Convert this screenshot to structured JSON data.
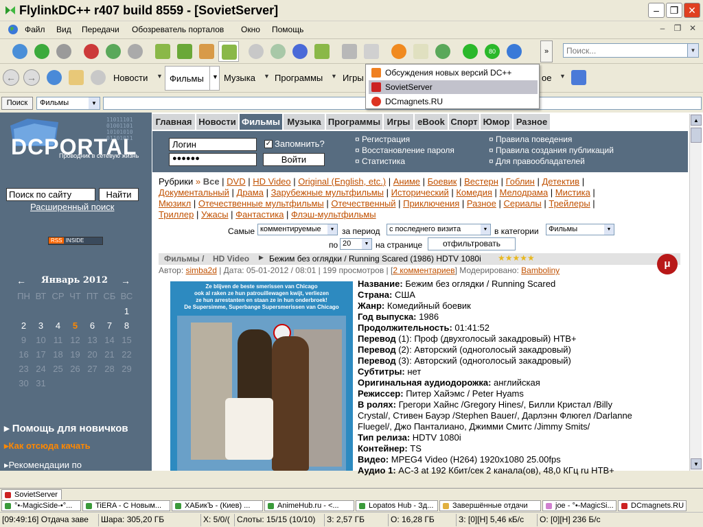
{
  "window": {
    "title": "FlylinkDC++ r407 build 8559 - [SovietServer]",
    "minimize": "–",
    "maximize": "❐",
    "close": "✕"
  },
  "menu": [
    "Файл",
    "Вид",
    "Передачи",
    "Обозреватель порталов",
    "Окно",
    "Помощь"
  ],
  "search_placeholder": "Поиск...",
  "toolbar2": {
    "news": "Новости",
    "films": "Фильмы",
    "music": "Музыка",
    "programs": "Программы",
    "games": "Игры",
    "more": "ое"
  },
  "dropdown": [
    {
      "label": "Обсуждения новых версий DC++",
      "color": "#f08020",
      "selected": false
    },
    {
      "label": "SovietServer",
      "color": "#cc2222",
      "selected": true
    },
    {
      "label": "DCmagnets.RU",
      "color": "#dd3322",
      "selected": false
    }
  ],
  "addr": {
    "button": "Поиск",
    "select": "Фильмы"
  },
  "sidebar": {
    "logo": "DCPORTAL",
    "tagline": "Проводник в сетевую жизнь",
    "search_value": "Поиск по сайту",
    "find": "Найти",
    "advanced": "Расширенный поиск",
    "rss1": "RSS",
    "rss2": "INSIDE",
    "help": "Помощь для новичков",
    "how": "Как отсюда качать",
    "rec": "Рекомендации по"
  },
  "calendar": {
    "title": "Январь 2012",
    "prev": "←",
    "next": "→",
    "days": [
      "ПН",
      "ВТ",
      "СР",
      "ЧТ",
      "ПТ",
      "СБ",
      "ВС"
    ],
    "rows": [
      [
        "",
        "",
        "",
        "",
        "",
        "",
        "1"
      ],
      [
        "2",
        "3",
        "4",
        "5",
        "6",
        "7",
        "8"
      ],
      [
        "9",
        "10",
        "11",
        "12",
        "13",
        "14",
        "15"
      ],
      [
        "16",
        "17",
        "18",
        "19",
        "20",
        "21",
        "22"
      ],
      [
        "23",
        "24",
        "25",
        "26",
        "27",
        "28",
        "29"
      ],
      [
        "30",
        "31",
        "",
        "",
        "",
        "",
        ""
      ]
    ],
    "today": "5"
  },
  "topnav": [
    "Главная",
    "Новости",
    "Фильмы",
    "Музыка",
    "Программы",
    "Игры",
    "eBook",
    "Спорт",
    "Юмор",
    "Разное"
  ],
  "login": {
    "login": "Логин",
    "password": "●●●●●●",
    "remember": "Запомнить?",
    "enter": "Войти",
    "links1": [
      "Регистрация",
      "Восстановление пароля",
      "Статистика"
    ],
    "links2": [
      "Правила поведения",
      "Правила создания публикаций",
      "Для правообладателей"
    ]
  },
  "rubrics": {
    "label": "Рубрики",
    "all": "Все",
    "line1": [
      "DVD",
      "HD Video",
      "Original (English, etc.)",
      "Аниме",
      "Боевик",
      "Вестерн",
      "Гоблин",
      "Детектив"
    ],
    "line2": [
      "Документальный",
      "Драма",
      "Зарубежные мультфильмы",
      "Исторический",
      "Комедия",
      "Мелодрама",
      "Мистика"
    ],
    "line3": [
      "Мюзикл",
      "Отечественные мультфильмы",
      "Отечественный",
      "Приключения",
      "Разное",
      "Сериалы",
      "Трейлеры"
    ],
    "line4": [
      "Триллер",
      "Ужасы",
      "Фантастика",
      "Флэш-мультфильмы"
    ]
  },
  "filter": {
    "most": "Самые",
    "most_val": "комментируемые",
    "period": "за период",
    "period_val": "с последнего визита",
    "cat": "в категории",
    "cat_val": "Фильмы",
    "per": "по",
    "per_val": "20",
    "per_page": "на странице",
    "btn": "отфильтровать"
  },
  "crumb": {
    "c1": "Фильмы /",
    "c2": "HD Video",
    "title": "Бежим без оглядки / Running Scared (1986) HDTV 1080i",
    "stars": "★★★★★"
  },
  "meta": {
    "author_label": "Автор:",
    "author": "simba2d",
    "date": "| Дата: 05-01-2012 / 08:01 | 199 просмотров | [",
    "comments": "2 комментариев",
    "mod": "] Модерировано:",
    "moderator": "Bambolinу"
  },
  "poster_text": [
    "Ze blijven de beste smerissen van Chicago",
    "ook al raken ze hun patrouillewagen kwijt, verliezen",
    "ze hun arrestanten en staan ze in hun onderbroek!",
    "De Supersimme, Superbange Supersmerissen van Chicago"
  ],
  "details": [
    {
      "k": "Название:",
      "v": "Бежим без оглядки / Running Scared"
    },
    {
      "k": "Страна:",
      "v": "США"
    },
    {
      "k": "Жанр:",
      "v": "Комедийный боевик"
    },
    {
      "k": "Год выпуска:",
      "v": "1986"
    },
    {
      "k": "Продолжительность:",
      "v": "01:41:52"
    },
    {
      "k": "Перевод",
      "v": "(1): Проф (двухголосый закадровый) НТВ+"
    },
    {
      "k": "Перевод",
      "v": "(2): Авторский (одноголосый закадровый)"
    },
    {
      "k": "Перевод",
      "v": "(3): Авторский (одноголосый закадровый)"
    },
    {
      "k": "Субтитры:",
      "v": "нет"
    },
    {
      "k": "Оригинальная аудиодорожка:",
      "v": "английская"
    },
    {
      "k": "Режиссер:",
      "v": "Питер Хайэмс / Peter Hyams"
    },
    {
      "k": "В ролях:",
      "v": "Грегори Хайнс /Gregory Hines/, Билли Кристал /Billy"
    },
    {
      "k": "",
      "v": "Crystal/, Стивен Бауэр /Stephen Bauer/, Дарлэнн Флюгел /Darlanne"
    },
    {
      "k": "",
      "v": "Fluegel/, Джо Панталиано, Джимми Смитс /Jimmy Smits/"
    },
    {
      "k": "Тип релиза:",
      "v": "HDTV 1080i"
    },
    {
      "k": "Контейнер:",
      "v": "TS"
    },
    {
      "k": "Видео:",
      "v": "MPEG4 Video (H264) 1920x1080 25.00fps"
    },
    {
      "k": "Аудио 1:",
      "v": "AC-3 at 192 Кбит/сек 2 канала(ов), 48,0 КГц ru НТВ+"
    }
  ],
  "tabs_top": "SovietServer",
  "tabs": [
    "°•-MagicSide-•°...",
    "TiERA - С Новым...",
    "ХАБикЪ - (Киев) ...",
    "AnimeHub.ru - <...",
    "Lopatos Hub - Зд...",
    "Завершённые отдачи",
    "joe - °•-MagicSi...",
    "DCmagnets.RU"
  ],
  "status": [
    "[09:49:16] Отдача заве",
    "Шара: 305,20 ГБ",
    "Х: 5/0/(",
    "Слоты: 15/15 (10/10)",
    "З: 2,57 ГБ",
    "О: 16,28 ГБ",
    "З: [0][Н] 5,46 кБ/с",
    "О: [0][Н] 236 Б/с"
  ]
}
